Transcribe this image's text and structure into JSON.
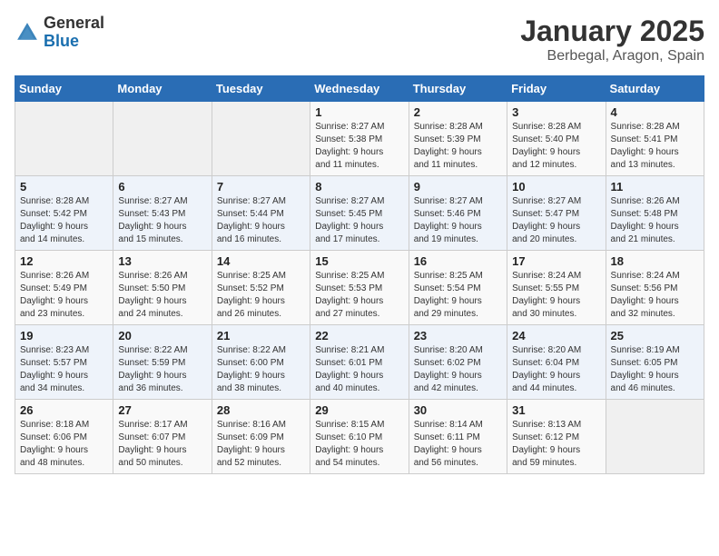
{
  "logo": {
    "line1": "General",
    "line2": "Blue"
  },
  "title": "January 2025",
  "location": "Berbegal, Aragon, Spain",
  "days_of_week": [
    "Sunday",
    "Monday",
    "Tuesday",
    "Wednesday",
    "Thursday",
    "Friday",
    "Saturday"
  ],
  "weeks": [
    [
      {
        "day": "",
        "detail": ""
      },
      {
        "day": "",
        "detail": ""
      },
      {
        "day": "",
        "detail": ""
      },
      {
        "day": "1",
        "detail": "Sunrise: 8:27 AM\nSunset: 5:38 PM\nDaylight: 9 hours\nand 11 minutes."
      },
      {
        "day": "2",
        "detail": "Sunrise: 8:28 AM\nSunset: 5:39 PM\nDaylight: 9 hours\nand 11 minutes."
      },
      {
        "day": "3",
        "detail": "Sunrise: 8:28 AM\nSunset: 5:40 PM\nDaylight: 9 hours\nand 12 minutes."
      },
      {
        "day": "4",
        "detail": "Sunrise: 8:28 AM\nSunset: 5:41 PM\nDaylight: 9 hours\nand 13 minutes."
      }
    ],
    [
      {
        "day": "5",
        "detail": "Sunrise: 8:28 AM\nSunset: 5:42 PM\nDaylight: 9 hours\nand 14 minutes."
      },
      {
        "day": "6",
        "detail": "Sunrise: 8:27 AM\nSunset: 5:43 PM\nDaylight: 9 hours\nand 15 minutes."
      },
      {
        "day": "7",
        "detail": "Sunrise: 8:27 AM\nSunset: 5:44 PM\nDaylight: 9 hours\nand 16 minutes."
      },
      {
        "day": "8",
        "detail": "Sunrise: 8:27 AM\nSunset: 5:45 PM\nDaylight: 9 hours\nand 17 minutes."
      },
      {
        "day": "9",
        "detail": "Sunrise: 8:27 AM\nSunset: 5:46 PM\nDaylight: 9 hours\nand 19 minutes."
      },
      {
        "day": "10",
        "detail": "Sunrise: 8:27 AM\nSunset: 5:47 PM\nDaylight: 9 hours\nand 20 minutes."
      },
      {
        "day": "11",
        "detail": "Sunrise: 8:26 AM\nSunset: 5:48 PM\nDaylight: 9 hours\nand 21 minutes."
      }
    ],
    [
      {
        "day": "12",
        "detail": "Sunrise: 8:26 AM\nSunset: 5:49 PM\nDaylight: 9 hours\nand 23 minutes."
      },
      {
        "day": "13",
        "detail": "Sunrise: 8:26 AM\nSunset: 5:50 PM\nDaylight: 9 hours\nand 24 minutes."
      },
      {
        "day": "14",
        "detail": "Sunrise: 8:25 AM\nSunset: 5:52 PM\nDaylight: 9 hours\nand 26 minutes."
      },
      {
        "day": "15",
        "detail": "Sunrise: 8:25 AM\nSunset: 5:53 PM\nDaylight: 9 hours\nand 27 minutes."
      },
      {
        "day": "16",
        "detail": "Sunrise: 8:25 AM\nSunset: 5:54 PM\nDaylight: 9 hours\nand 29 minutes."
      },
      {
        "day": "17",
        "detail": "Sunrise: 8:24 AM\nSunset: 5:55 PM\nDaylight: 9 hours\nand 30 minutes."
      },
      {
        "day": "18",
        "detail": "Sunrise: 8:24 AM\nSunset: 5:56 PM\nDaylight: 9 hours\nand 32 minutes."
      }
    ],
    [
      {
        "day": "19",
        "detail": "Sunrise: 8:23 AM\nSunset: 5:57 PM\nDaylight: 9 hours\nand 34 minutes."
      },
      {
        "day": "20",
        "detail": "Sunrise: 8:22 AM\nSunset: 5:59 PM\nDaylight: 9 hours\nand 36 minutes."
      },
      {
        "day": "21",
        "detail": "Sunrise: 8:22 AM\nSunset: 6:00 PM\nDaylight: 9 hours\nand 38 minutes."
      },
      {
        "day": "22",
        "detail": "Sunrise: 8:21 AM\nSunset: 6:01 PM\nDaylight: 9 hours\nand 40 minutes."
      },
      {
        "day": "23",
        "detail": "Sunrise: 8:20 AM\nSunset: 6:02 PM\nDaylight: 9 hours\nand 42 minutes."
      },
      {
        "day": "24",
        "detail": "Sunrise: 8:20 AM\nSunset: 6:04 PM\nDaylight: 9 hours\nand 44 minutes."
      },
      {
        "day": "25",
        "detail": "Sunrise: 8:19 AM\nSunset: 6:05 PM\nDaylight: 9 hours\nand 46 minutes."
      }
    ],
    [
      {
        "day": "26",
        "detail": "Sunrise: 8:18 AM\nSunset: 6:06 PM\nDaylight: 9 hours\nand 48 minutes."
      },
      {
        "day": "27",
        "detail": "Sunrise: 8:17 AM\nSunset: 6:07 PM\nDaylight: 9 hours\nand 50 minutes."
      },
      {
        "day": "28",
        "detail": "Sunrise: 8:16 AM\nSunset: 6:09 PM\nDaylight: 9 hours\nand 52 minutes."
      },
      {
        "day": "29",
        "detail": "Sunrise: 8:15 AM\nSunset: 6:10 PM\nDaylight: 9 hours\nand 54 minutes."
      },
      {
        "day": "30",
        "detail": "Sunrise: 8:14 AM\nSunset: 6:11 PM\nDaylight: 9 hours\nand 56 minutes."
      },
      {
        "day": "31",
        "detail": "Sunrise: 8:13 AM\nSunset: 6:12 PM\nDaylight: 9 hours\nand 59 minutes."
      },
      {
        "day": "",
        "detail": ""
      }
    ]
  ]
}
